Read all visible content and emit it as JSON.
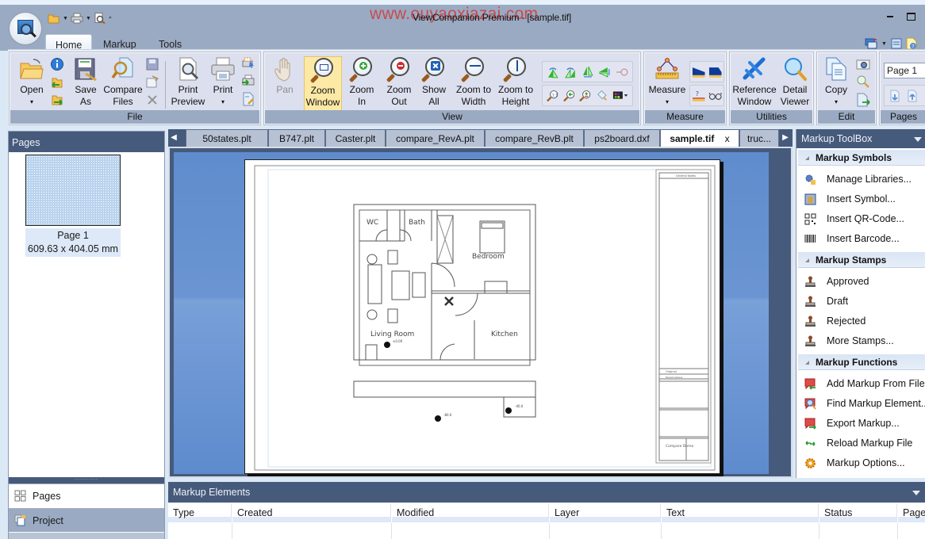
{
  "window": {
    "title": "ViewCompanion Premium - [sample.tif]",
    "watermark": "www.ouyaoxiazai.com"
  },
  "quick_access": [
    "open-icon",
    "print-icon",
    "print-preview-icon"
  ],
  "ribbon_tabs": [
    "Home",
    "Markup",
    "Tools"
  ],
  "active_ribbon_tab": "Home",
  "ribbon": {
    "file": {
      "label": "File",
      "open": [
        "Open",
        "▾"
      ],
      "save_as": [
        "Save",
        "As"
      ],
      "compare": [
        "Compare",
        "Files"
      ],
      "print_preview": [
        "Print",
        "Preview"
      ],
      "print": [
        "Print",
        "▾"
      ]
    },
    "view": {
      "label": "View",
      "pan": "Pan",
      "zoom_window": [
        "Zoom",
        "Window"
      ],
      "zoom_in": [
        "Zoom",
        "In"
      ],
      "zoom_out": [
        "Zoom",
        "Out"
      ],
      "show_all": [
        "Show",
        "All"
      ],
      "zoom_width": [
        "Zoom to",
        "Width"
      ],
      "zoom_height": [
        "Zoom to",
        "Height"
      ]
    },
    "measure": {
      "label": "Measure",
      "measure": [
        "Measure",
        "▾"
      ]
    },
    "utilities": {
      "label": "Utilities",
      "reference": [
        "Reference",
        "Window"
      ],
      "detail": [
        "Detail",
        "Viewer"
      ]
    },
    "edit": {
      "label": "Edit",
      "copy": [
        "Copy",
        "▾"
      ]
    },
    "pages": {
      "label": "Pages",
      "page_select": "Page 1"
    }
  },
  "left_panel": {
    "title": "Pages",
    "thumbnail": {
      "label": "Page 1",
      "size": "609.63 x 404.05 mm"
    },
    "splitter": "··········",
    "nav": [
      {
        "label": "Pages",
        "icon": "pages-grid-icon",
        "active": false
      },
      {
        "label": "Project",
        "icon": "project-icon",
        "active": true
      }
    ]
  },
  "document_tabs": [
    {
      "label": "50states.plt",
      "active": false
    },
    {
      "label": "B747.plt",
      "active": false
    },
    {
      "label": "Caster.plt",
      "active": false
    },
    {
      "label": "compare_RevA.plt",
      "active": false
    },
    {
      "label": "compare_RevB.plt",
      "active": false
    },
    {
      "label": "ps2board.dxf",
      "active": false
    },
    {
      "label": "sample.tif",
      "active": true,
      "close": "x"
    },
    {
      "label": "truc...",
      "active": false
    }
  ],
  "drawing": {
    "rooms": [
      "WC",
      "Bath",
      "Bedroom",
      "Living  Room",
      "Kitchen"
    ],
    "levels": [
      "±0.00",
      "-80.0",
      "-40.0"
    ],
    "title_block": {
      "notes_header": "General Notes",
      "rev": [
        "01",
        "Original",
        "2008"
      ],
      "rev_header": [
        "No.",
        "Revision/Issue",
        "Date"
      ],
      "project": "Compare Demo"
    }
  },
  "toolbox": {
    "title": "Markup ToolBox",
    "sections": [
      {
        "title": "Markup Symbols",
        "items": [
          {
            "label": "Manage Libraries...",
            "icon": "gear-library-icon"
          },
          {
            "label": "Insert Symbol...",
            "icon": "symbol-icon"
          },
          {
            "label": "Insert QR-Code...",
            "icon": "qr-code-icon"
          },
          {
            "label": "Insert Barcode...",
            "icon": "barcode-icon"
          }
        ]
      },
      {
        "title": "Markup Stamps",
        "items": [
          {
            "label": "Approved",
            "icon": "stamp-icon"
          },
          {
            "label": "Draft",
            "icon": "stamp-icon"
          },
          {
            "label": "Rejected",
            "icon": "stamp-icon"
          },
          {
            "label": "More Stamps...",
            "icon": "stamp-icon"
          }
        ]
      },
      {
        "title": "Markup Functions",
        "items": [
          {
            "label": "Add Markup From File...",
            "icon": "add-markup-icon"
          },
          {
            "label": "Find Markup Element...",
            "icon": "find-markup-icon"
          },
          {
            "label": "Export Markup...",
            "icon": "export-markup-icon"
          },
          {
            "label": "Reload Markup File",
            "icon": "reload-icon"
          },
          {
            "label": "Markup Options...",
            "icon": "options-gear-icon"
          }
        ]
      }
    ]
  },
  "markup_elements": {
    "title": "Markup Elements",
    "columns": [
      "Type",
      "Created",
      "Modified",
      "Layer",
      "Text",
      "Status",
      "Page"
    ]
  },
  "colors": {
    "panel_header": "#465a7b",
    "ribbon_label": "#9aaac2",
    "active_button": "#fde9a6",
    "watermark": "#d23a3a"
  }
}
